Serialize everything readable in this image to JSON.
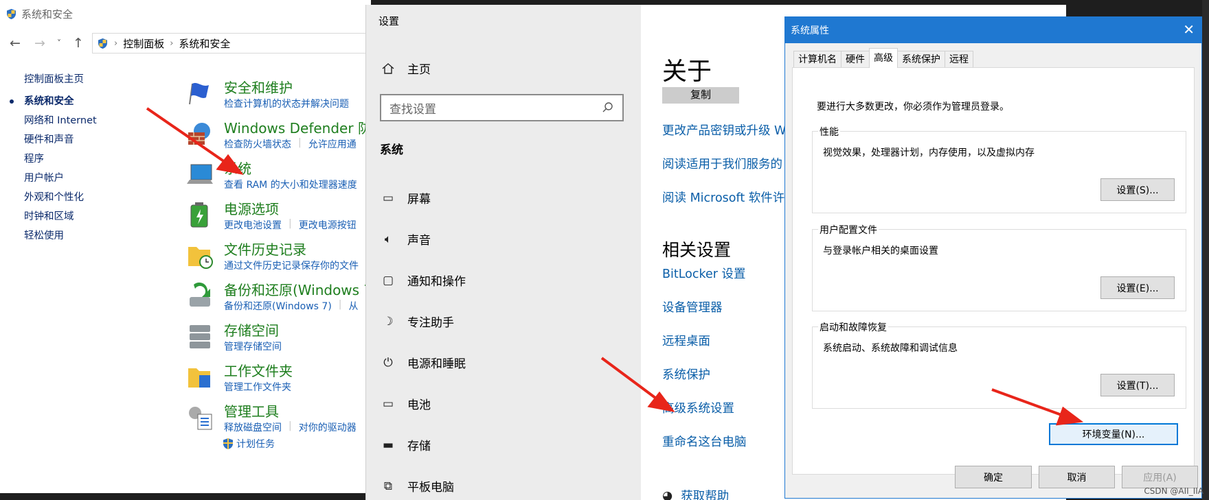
{
  "control_panel": {
    "title": "系统和安全",
    "breadcrumb": [
      "控制面板",
      "系统和安全"
    ],
    "sidebar": [
      "控制面板主页",
      "系统和安全",
      "网络和 Internet",
      "硬件和声音",
      "程序",
      "用户帐户",
      "外观和个性化",
      "时钟和区域",
      "轻松使用"
    ],
    "categories": [
      {
        "title": "安全和维护",
        "links": [
          "检查计算机的状态并解决问题"
        ]
      },
      {
        "title": "Windows Defender 防",
        "links": [
          "检查防火墙状态",
          "允许应用通"
        ]
      },
      {
        "title": "系统",
        "links": [
          "查看 RAM 的大小和处理器速度"
        ]
      },
      {
        "title": "电源选项",
        "links": [
          "更改电池设置",
          "更改电源按钮"
        ]
      },
      {
        "title": "文件历史记录",
        "links": [
          "通过文件历史记录保存你的文件"
        ]
      },
      {
        "title": "备份和还原(Windows 7",
        "links": [
          "备份和还原(Windows 7)",
          "从"
        ]
      },
      {
        "title": "存储空间",
        "links": [
          "管理存储空间"
        ]
      },
      {
        "title": "工作文件夹",
        "links": [
          "管理工作文件夹"
        ]
      },
      {
        "title": "管理工具",
        "links": [
          "释放磁盘空间",
          "对你的驱动器"
        ]
      }
    ],
    "extra_link": "计划任务"
  },
  "settings": {
    "title": "设置",
    "home": "主页",
    "search_placeholder": "查找设置",
    "section": "系统",
    "items": [
      "屏幕",
      "声音",
      "通知和操作",
      "专注助手",
      "电源和睡眠",
      "电池",
      "存储",
      "平板电脑"
    ],
    "about_title": "关于",
    "copy_button": "复制",
    "links": [
      "更改产品密钥或升级 W",
      "阅读适用于我们服务的",
      "阅读 Microsoft 软件许可"
    ],
    "related_title": "相关设置",
    "related_links": [
      "BitLocker 设置",
      "设备管理器",
      "远程桌面",
      "系统保护",
      "高级系统设置",
      "重命名这台电脑"
    ],
    "help_link": "获取帮助"
  },
  "dialog": {
    "title": "系统属性",
    "tabs": [
      "计算机名",
      "硬件",
      "高级",
      "系统保护",
      "远程"
    ],
    "active_tab": "高级",
    "note": "要进行大多数更改，你必须作为管理员登录。",
    "groups": [
      {
        "legend": "性能",
        "desc": "视觉效果，处理器计划，内存使用，以及虚拟内存",
        "button": "设置(S)..."
      },
      {
        "legend": "用户配置文件",
        "desc": "与登录帐户相关的桌面设置",
        "button": "设置(E)..."
      },
      {
        "legend": "启动和故障恢复",
        "desc": "系统启动、系统故障和调试信息",
        "button": "设置(T)..."
      }
    ],
    "env_button": "环境变量(N)...",
    "ok": "确定",
    "cancel": "取消",
    "apply": "应用(A)"
  },
  "watermark": "CSDN @AII_IIA",
  "colors": {
    "accent": "#1f78d1",
    "arrow": "#e8251a",
    "link_green": "#1e7e1e"
  }
}
